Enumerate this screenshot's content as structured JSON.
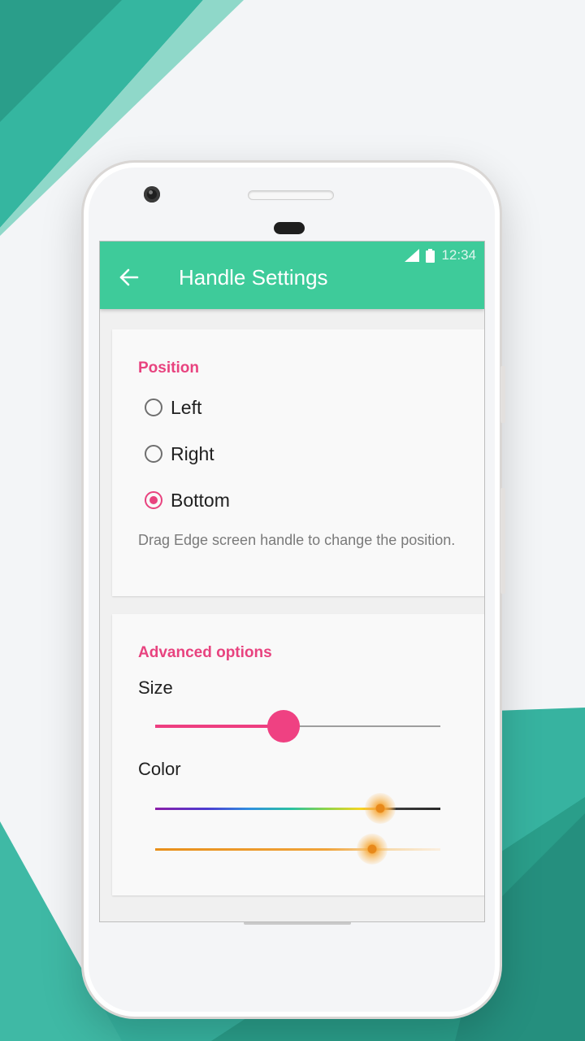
{
  "status_bar": {
    "time": "12:34"
  },
  "app_bar": {
    "title": "Handle Settings",
    "back_icon": "arrow-left-icon"
  },
  "position_section": {
    "title": "Position",
    "options": [
      {
        "label": "Left",
        "selected": false
      },
      {
        "label": "Right",
        "selected": false
      },
      {
        "label": "Bottom",
        "selected": true
      }
    ],
    "help_text": "Drag Edge screen handle to change the position."
  },
  "advanced_section": {
    "title": "Advanced options",
    "size_label": "Size",
    "size_value": 0.45,
    "color_label": "Color",
    "hue_value": 0.79,
    "shade_value": 0.76
  },
  "colors": {
    "accent": "#e8437f",
    "toolbar": "#3ecb9a",
    "brand_teal": "#2aa593"
  }
}
